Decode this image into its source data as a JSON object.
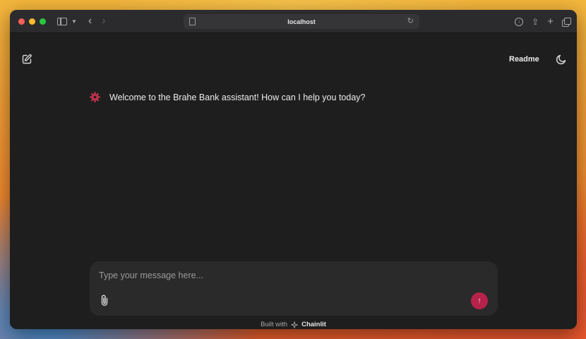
{
  "browser": {
    "url": "localhost"
  },
  "header": {
    "readme_label": "Readme"
  },
  "messages": [
    {
      "text": "Welcome to the Brahe Bank assistant! How can I help you today?"
    }
  ],
  "composer": {
    "placeholder": "Type your message here..."
  },
  "footer": {
    "built_with": "Built with",
    "brand": "Chainlit"
  },
  "colors": {
    "accent": "#b5234a",
    "background": "#1e1e1e",
    "composer": "#2a2a2a"
  },
  "icons": {
    "new_chat": "edit-icon",
    "theme": "moon-icon",
    "avatar": "gear-icon",
    "attach": "paperclip-icon",
    "send": "arrow-up-icon"
  }
}
